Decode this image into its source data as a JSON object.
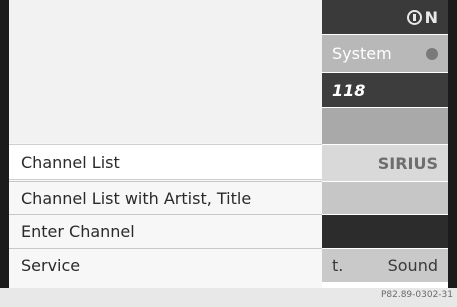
{
  "status_panel": {
    "top_indicator": "N",
    "band_label": "System",
    "channel_number": "118",
    "provider_logo": "SIRIUS",
    "truncated_label": "t.",
    "sound_label": "Sound"
  },
  "menu": {
    "items": [
      {
        "label": "Channel List",
        "selected": true
      },
      {
        "label": "Channel List with Artist, Title",
        "selected": false
      },
      {
        "label": "Enter Channel",
        "selected": false
      },
      {
        "label": "Service",
        "selected": false
      }
    ]
  },
  "footer": {
    "reference": "P82.89-0302-31"
  },
  "colors": {
    "frame": "#1b1b1b",
    "menu_bg": "#f7f7f7",
    "selected_bg": "#ffffff"
  },
  "icons": [
    "info-icon",
    "settings-dot-icon",
    "sirius-logo-icon"
  ]
}
